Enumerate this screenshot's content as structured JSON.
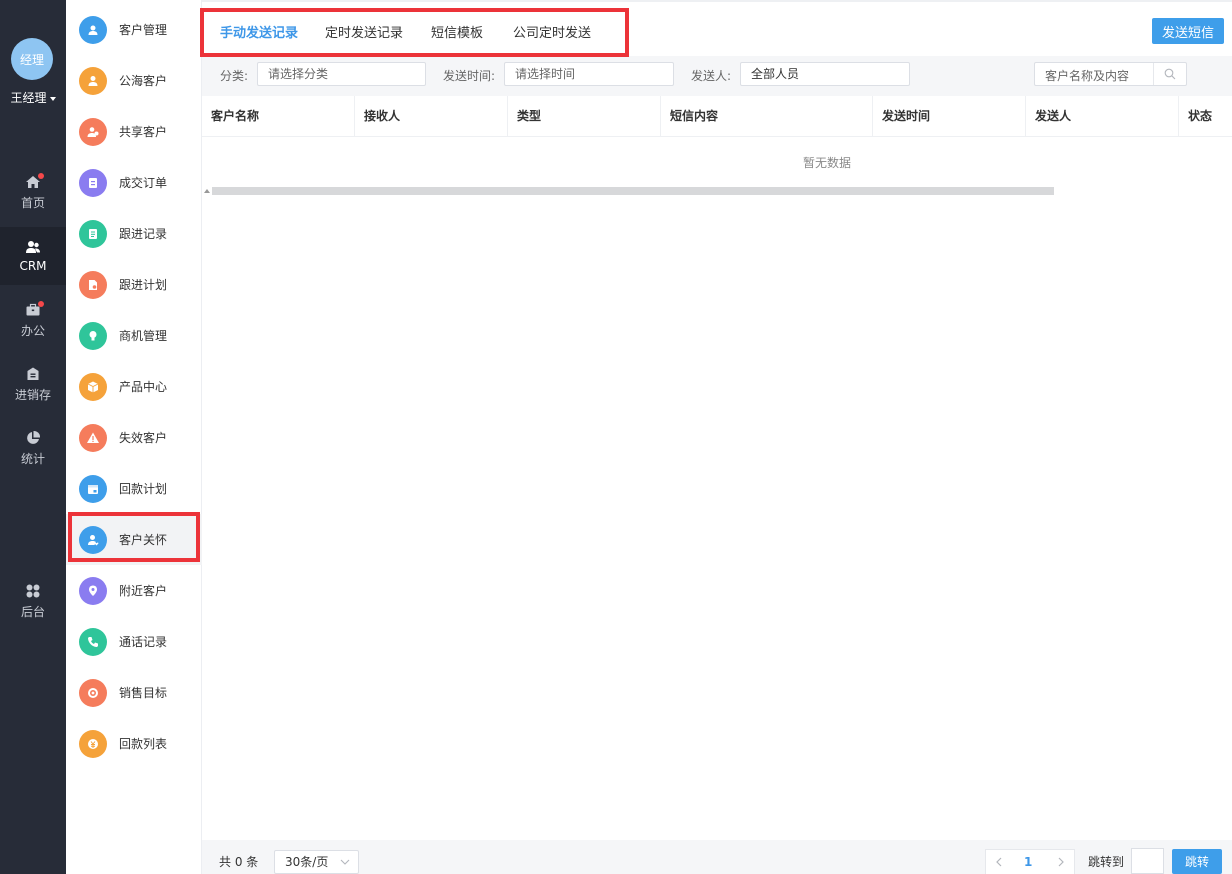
{
  "user": {
    "avatar_text": "经理",
    "name": "王经理"
  },
  "nav": [
    {
      "label": "首页",
      "icon": "home-icon",
      "badge": true
    },
    {
      "label": "CRM",
      "icon": "users-icon",
      "active": true
    },
    {
      "label": "办公",
      "icon": "briefcase-icon",
      "badge": true
    },
    {
      "label": "进销存",
      "icon": "inventory-icon"
    },
    {
      "label": "统计",
      "icon": "pie-chart-icon"
    },
    {
      "label": "后台",
      "icon": "apps-icon"
    }
  ],
  "submenu": [
    {
      "label": "客户管理",
      "icon": "customers-icon",
      "color": "#3e9eea"
    },
    {
      "label": "公海客户",
      "icon": "public-customer-icon",
      "color": "#f5a23a"
    },
    {
      "label": "共享客户",
      "icon": "shared-customer-icon",
      "color": "#f57c5c"
    },
    {
      "label": "成交订单",
      "icon": "order-icon",
      "color": "#8a7cf0"
    },
    {
      "label": "跟进记录",
      "icon": "record-icon",
      "color": "#2fc59a"
    },
    {
      "label": "跟进计划",
      "icon": "plan-icon",
      "color": "#f57c5c"
    },
    {
      "label": "商机管理",
      "icon": "bulb-icon",
      "color": "#2fc59a"
    },
    {
      "label": "产品中心",
      "icon": "box-icon",
      "color": "#f5a23a"
    },
    {
      "label": "失效客户",
      "icon": "warning-icon",
      "color": "#f57c5c"
    },
    {
      "label": "回款计划",
      "icon": "calendar-icon",
      "color": "#3e9eea"
    },
    {
      "label": "客户关怀",
      "icon": "care-icon",
      "color": "#3e9eea",
      "active": true
    },
    {
      "label": "附近客户",
      "icon": "location-icon",
      "color": "#8a7cf0"
    },
    {
      "label": "通话记录",
      "icon": "phone-icon",
      "color": "#2fc59a"
    },
    {
      "label": "销售目标",
      "icon": "target-icon",
      "color": "#f57c5c"
    },
    {
      "label": "回款列表",
      "icon": "money-icon",
      "color": "#f5a23a"
    }
  ],
  "tabs": [
    {
      "label": "手动发送记录",
      "active": true
    },
    {
      "label": "定时发送记录"
    },
    {
      "label": "短信模板"
    },
    {
      "label": "公司定时发送"
    }
  ],
  "send_button": "发送短信",
  "filters": {
    "category_label": "分类:",
    "category_placeholder": "请选择分类",
    "time_label": "发送时间:",
    "time_placeholder": "请选择时间",
    "sender_label": "发送人:",
    "sender_value": "全部人员",
    "search_placeholder": "客户名称及内容"
  },
  "table": {
    "columns": [
      "客户名称",
      "接收人",
      "类型",
      "短信内容",
      "发送时间",
      "发送人",
      "状态"
    ],
    "empty_text": "暂无数据"
  },
  "footer": {
    "total": "共 0 条",
    "page_size": "30条/页",
    "current_page": "1",
    "goto_label": "跳转到",
    "goto_button": "跳转"
  },
  "colors": {
    "accent": "#3e9eea",
    "highlight": "#ec3339",
    "nav_bg": "#272c38"
  }
}
